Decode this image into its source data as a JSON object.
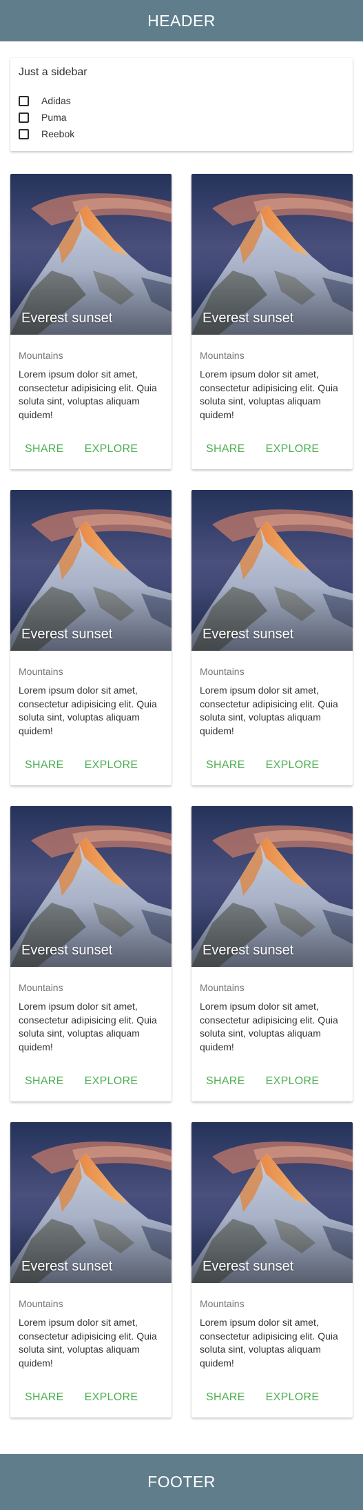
{
  "header": {
    "title": "HEADER"
  },
  "sidebar": {
    "title": "Just a sidebar",
    "items": [
      {
        "label": "Adidas",
        "checked": false
      },
      {
        "label": "Puma",
        "checked": false
      },
      {
        "label": "Reebok",
        "checked": false
      }
    ]
  },
  "cards": [
    {
      "image_title": "Everest sunset",
      "category": "Mountains",
      "text": "Lorem ipsum dolor sit amet, consectetur adipisicing elit. Quia soluta sint, voluptas aliquam quidem!",
      "share": "SHARE",
      "explore": "EXPLORE"
    },
    {
      "image_title": "Everest sunset",
      "category": "Mountains",
      "text": "Lorem ipsum dolor sit amet, consectetur adipisicing elit. Quia soluta sint, voluptas aliquam quidem!",
      "share": "SHARE",
      "explore": "EXPLORE"
    },
    {
      "image_title": "Everest sunset",
      "category": "Mountains",
      "text": "Lorem ipsum dolor sit amet, consectetur adipisicing elit. Quia soluta sint, voluptas aliquam quidem!",
      "share": "SHARE",
      "explore": "EXPLORE"
    },
    {
      "image_title": "Everest sunset",
      "category": "Mountains",
      "text": "Lorem ipsum dolor sit amet, consectetur adipisicing elit. Quia soluta sint, voluptas aliquam quidem!",
      "share": "SHARE",
      "explore": "EXPLORE"
    },
    {
      "image_title": "Everest sunset",
      "category": "Mountains",
      "text": "Lorem ipsum dolor sit amet, consectetur adipisicing elit. Quia soluta sint, voluptas aliquam quidem!",
      "share": "SHARE",
      "explore": "EXPLORE"
    },
    {
      "image_title": "Everest sunset",
      "category": "Mountains",
      "text": "Lorem ipsum dolor sit amet, consectetur adipisicing elit. Quia soluta sint, voluptas aliquam quidem!",
      "share": "SHARE",
      "explore": "EXPLORE"
    },
    {
      "image_title": "Everest sunset",
      "category": "Mountains",
      "text": "Lorem ipsum dolor sit amet, consectetur adipisicing elit. Quia soluta sint, voluptas aliquam quidem!",
      "share": "SHARE",
      "explore": "EXPLORE"
    },
    {
      "image_title": "Everest sunset",
      "category": "Mountains",
      "text": "Lorem ipsum dolor sit amet, consectetur adipisicing elit. Quia soluta sint, voluptas aliquam quidem!",
      "share": "SHARE",
      "explore": "EXPLORE"
    }
  ],
  "footer": {
    "title": "FOOTER"
  },
  "colors": {
    "bar": "#607d8b",
    "action": "#4caf50"
  }
}
